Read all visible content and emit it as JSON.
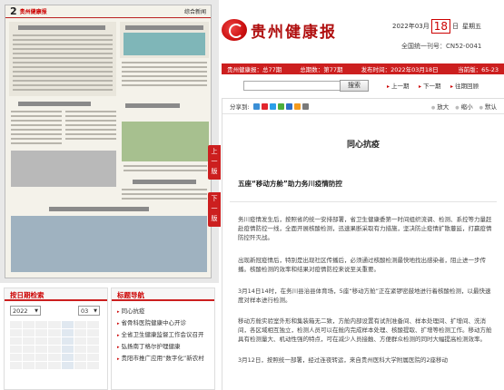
{
  "paper": {
    "page_number": "2",
    "logo_text": "贵州健康报",
    "section": "综合新闻"
  },
  "flip": {
    "prev": "上一版",
    "next": "下一版"
  },
  "header": {
    "logo": "贵州健康报",
    "date_prefix": "2022年03月",
    "date_day": "18",
    "date_suffix": "日",
    "weekday": "星期五",
    "cn": "全国统一刊号：CN52-0041",
    "bar": {
      "paper_name": "贵州健康报：总77期",
      "period": "总期数：第77期",
      "pub_date": "发布时间：2022年03月18日",
      "page": "当前版：65-23"
    }
  },
  "search": {
    "placeholder": "",
    "button": "搜索",
    "links": [
      "上一期",
      "下一期",
      "往期回顾"
    ]
  },
  "article": {
    "share_label": "分享到:",
    "font_controls": [
      "放大",
      "缩小",
      "默认"
    ],
    "column_title": "同心抗疫",
    "title": "五座“移动方舱”助力务川疫情防控",
    "paragraphs": [
      "务川疫情发生后，按照省的统一安排部署，省卫生健康委第一时间组织流调、检测、系控等力量赶赴疫情防控一线，全面开展核酸检测，迅速果断采取有力措施，坚决防止疫情扩散蔓延，打赢疫情防控歼灭战。",
      "出现新冠疫情后，特别是出现社区传播后，必须通过核酸检测最快地找出感染者，阻止进一步传播。核酸检测的效率和结果对疫情防控来说至关重要。",
      "3月14日14时，在务川县治县体育场，5座“移动方舱”正在紧锣密鼓地进行着核酸检测，以最快速度对样本进行检测。",
      "移动方舱实验室外形和集装箱无二致，方舱内部设置有试剂准备间、样本处理间、扩增间、洗消间，各区域相互独立，检测人员可以在舱内完成样本处理、核酸提取、扩增等检测工作。移动方舱具有检测量大、机动性强的特点，可在减少人员接触、方便群众检测的同时大幅提高检测效率。",
      "3月12日，按照统一部署，经过连夜转运，来自贵州医科大学附属医院的2座移动"
    ]
  },
  "date_panel": {
    "title": "按日期检索",
    "year": "2022",
    "month": "03"
  },
  "nav_panel": {
    "title": "标题导航",
    "items": [
      "同心抗疫",
      "省骨科医院健康中心开诊",
      "全省卫生健康监督工作会议召开",
      "弘扬南丁格尔护理健康",
      "贵阳市推广应用“数字化”新农村"
    ]
  },
  "colors": {
    "brand_red": "#cc1f1f",
    "logo_red": "#b01010"
  }
}
